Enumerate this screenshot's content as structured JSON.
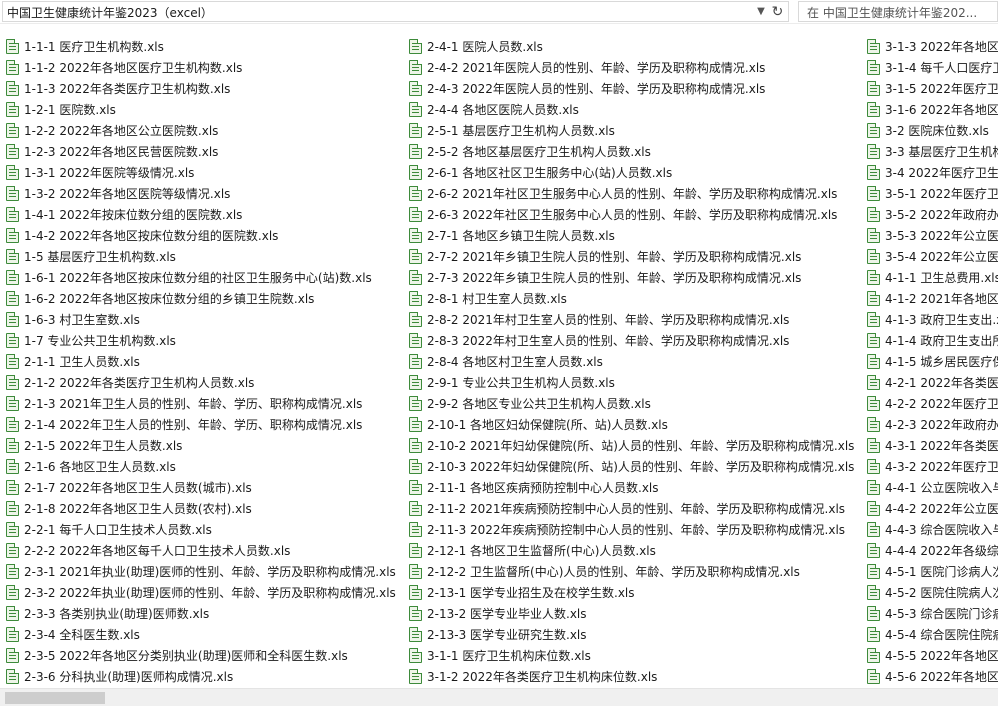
{
  "address": {
    "path": "中国卫生健康统计年鉴2023（excel）"
  },
  "search": {
    "placeholder": "在 中国卫生健康统计年鉴202..."
  },
  "icons": {
    "dropdown": "chevron-down-icon",
    "refresh": "refresh-icon",
    "file": "excel-file-icon"
  },
  "colors": {
    "icon": "#3d8a3a",
    "scroll_thumb": "#cdcdcd"
  },
  "columns": [
    {
      "items": [
        "1-1-1 医疗卫生机构数.xls",
        "1-1-2 2022年各地区医疗卫生机构数.xls",
        "1-1-3 2022年各类医疗卫生机构数.xls",
        "1-2-1 医院数.xls",
        "1-2-2 2022年各地区公立医院数.xls",
        "1-2-3 2022年各地区民营医院数.xls",
        "1-3-1 2022年医院等级情况.xls",
        "1-3-2 2022年各地区医院等级情况.xls",
        "1-4-1 2022年按床位数分组的医院数.xls",
        "1-4-2 2022年各地区按床位数分组的医院数.xls",
        "1-5 基层医疗卫生机构数.xls",
        "1-6-1 2022年各地区按床位数分组的社区卫生服务中心(站)数.xls",
        "1-6-2 2022年各地区按床位数分组的乡镇卫生院数.xls",
        "1-6-3 村卫生室数.xls",
        "1-7 专业公共卫生机构数.xls",
        "2-1-1 卫生人员数.xls",
        "2-1-2 2022年各类医疗卫生机构人员数.xls",
        "2-1-3 2021年卫生人员的性别、年龄、学历、职称构成情况.xls",
        "2-1-4 2022年卫生人员的性别、年龄、学历、职称构成情况.xls",
        "2-1-5 2022年卫生人员数.xls",
        "2-1-6 各地区卫生人员数.xls",
        "2-1-7 2022年各地区卫生人员数(城市).xls",
        "2-1-8 2022年各地区卫生人员数(农村).xls",
        "2-2-1 每千人口卫生技术人员数.xls",
        "2-2-2 2022年各地区每千人口卫生技术人员数.xls",
        "2-3-1 2021年执业(助理)医师的性别、年龄、学历及职称构成情况.xls",
        "2-3-2 2022年执业(助理)医师的性别、年龄、学历及职称构成情况.xls",
        "2-3-3 各类别执业(助理)医师数.xls",
        "2-3-4 全科医生数.xls",
        "2-3-5 2022年各地区分类别执业(助理)医师和全科医生数.xls",
        "2-3-6 分科执业(助理)医师构成情况.xls"
      ]
    },
    {
      "items": [
        "2-4-1 医院人员数.xls",
        "2-4-2 2021年医院人员的性别、年龄、学历及职称构成情况.xls",
        "2-4-3 2022年医院人员的性别、年龄、学历及职称构成情况.xls",
        "2-4-4 各地区医院人员数.xls",
        "2-5-1 基层医疗卫生机构人员数.xls",
        "2-5-2 各地区基层医疗卫生机构人员数.xls",
        "2-6-1 各地区社区卫生服务中心(站)人员数.xls",
        "2-6-2 2021年社区卫生服务中心人员的性别、年龄、学历及职称构成情况.xls",
        "2-6-3 2022年社区卫生服务中心人员的性别、年龄、学历及职称构成情况.xls",
        "2-7-1 各地区乡镇卫生院人员数.xls",
        "2-7-2 2021年乡镇卫生院人员的性别、年龄、学历及职称构成情况.xls",
        "2-7-3 2022年乡镇卫生院人员的性别、年龄、学历及职称构成情况.xls",
        "2-8-1 村卫生室人员数.xls",
        "2-8-2 2021年村卫生室人员的性别、年龄、学历及职称构成情况.xls",
        "2-8-3 2022年村卫生室人员的性别、年龄、学历及职称构成情况.xls",
        "2-8-4 各地区村卫生室人员数.xls",
        "2-9-1 专业公共卫生机构人员数.xls",
        "2-9-2 各地区专业公共卫生机构人员数.xls",
        "2-10-1 各地区妇幼保健院(所、站)人员数.xls",
        "2-10-2 2021年妇幼保健院(所、站)人员的性别、年龄、学历及职称构成情况.xls",
        "2-10-3 2022年妇幼保健院(所、站)人员的性别、年龄、学历及职称构成情况.xls",
        "2-11-1 各地区疾病预防控制中心人员数.xls",
        "2-11-2 2021年疾病预防控制中心人员的性别、年龄、学历及职称构成情况.xls",
        "2-11-3 2022年疾病预防控制中心人员的性别、年龄、学历及职称构成情况.xls",
        "2-12-1 各地区卫生监督所(中心)人员数.xls",
        "2-12-2 卫生监督所(中心)人员的性别、年龄、学历及职称构成情况.xls",
        "2-13-1 医学专业招生及在校学生数.xls",
        "2-13-2 医学专业毕业人数.xls",
        "2-13-3 医学专业研究生数.xls",
        "3-1-1 医疗卫生机构床位数.xls",
        "3-1-2 2022年各类医疗卫生机构床位数.xls"
      ]
    },
    {
      "items": [
        "3-1-3 2022年各地区",
        "3-1-4 每千人口医疗卫",
        "3-1-5 2022年医疗卫生",
        "3-1-6 2022年各地区",
        "3-2 医院床位数.xls",
        "3-3 基层医疗卫生机构",
        "3-4 2022年医疗卫生",
        "3-5-1 2022年医疗卫生",
        "3-5-2 2022年政府办医",
        "3-5-3 2022年公立医",
        "3-5-4 2022年公立医",
        "4-1-1 卫生总费用.xls",
        "4-1-2 2021年各地区",
        "4-1-3 政府卫生支出.xls",
        "4-1-4 政府卫生支出所",
        "4-1-5 城乡居民医疗保",
        "4-2-1 2022年各类医疗",
        "4-2-2 2022年医疗卫生",
        "4-2-3 2022年政府办医",
        "4-3-1 2022年各类医疗",
        "4-3-2 2022年医疗卫生",
        "4-4-1 公立医院收入与",
        "4-4-2 2022年公立医",
        "4-4-3 综合医院收入与",
        "4-4-4 2022年各级综合",
        "4-5-1 医院门诊病人次",
        "4-5-2 医院住院病人次",
        "4-5-3 综合医院门诊病",
        "4-5-4 综合医院住院病",
        "4-5-5 2022年各地区医",
        "4-5-6 2022年各地区公"
      ]
    }
  ]
}
